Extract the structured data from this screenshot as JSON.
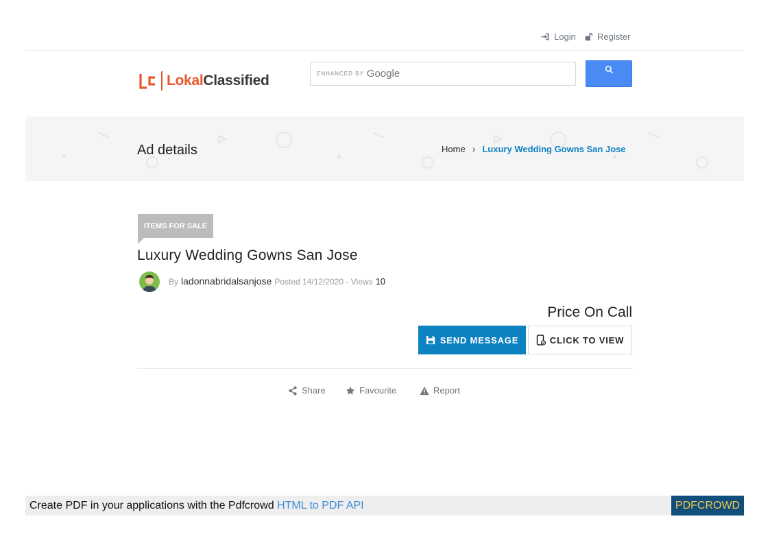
{
  "topbar": {
    "login_label": "Login",
    "register_label": "Register"
  },
  "header": {
    "logo_part1": "Lokal",
    "logo_part2": "Classified",
    "search": {
      "enhanced_by": "ENHANCED BY",
      "provider": "Google",
      "button_icon": "search-icon"
    }
  },
  "banner": {
    "heading": "Ad details",
    "breadcrumb": {
      "home": "Home",
      "separator": "›",
      "current": "Luxury Wedding Gowns San Jose"
    }
  },
  "ad": {
    "category_tag": "ITEMS FOR SALE",
    "title": "Luxury Wedding Gowns San Jose",
    "by_label": "By",
    "author": "ladonnabridalsanjose",
    "posted": "Posted 14/12/2020 - Views",
    "views": "10",
    "price": "Price On Call",
    "send_message_label": "SEND MESSAGE",
    "click_to_view_label": "CLICK TO VIEW"
  },
  "actions": {
    "share": "Share",
    "favourite": "Favourite",
    "report": "Report"
  },
  "pdfcrowd": {
    "text": "Create PDF in your applications with the Pdfcrowd",
    "link": "HTML to PDF API",
    "button": "PDFCROWD"
  },
  "colors": {
    "accent_blue": "#0d82c3",
    "logo_orange": "#e8562a",
    "google_button": "#4a8af4",
    "pdfcrowd_bg": "#114e7c",
    "pdfcrowd_text": "#f3c84a"
  }
}
